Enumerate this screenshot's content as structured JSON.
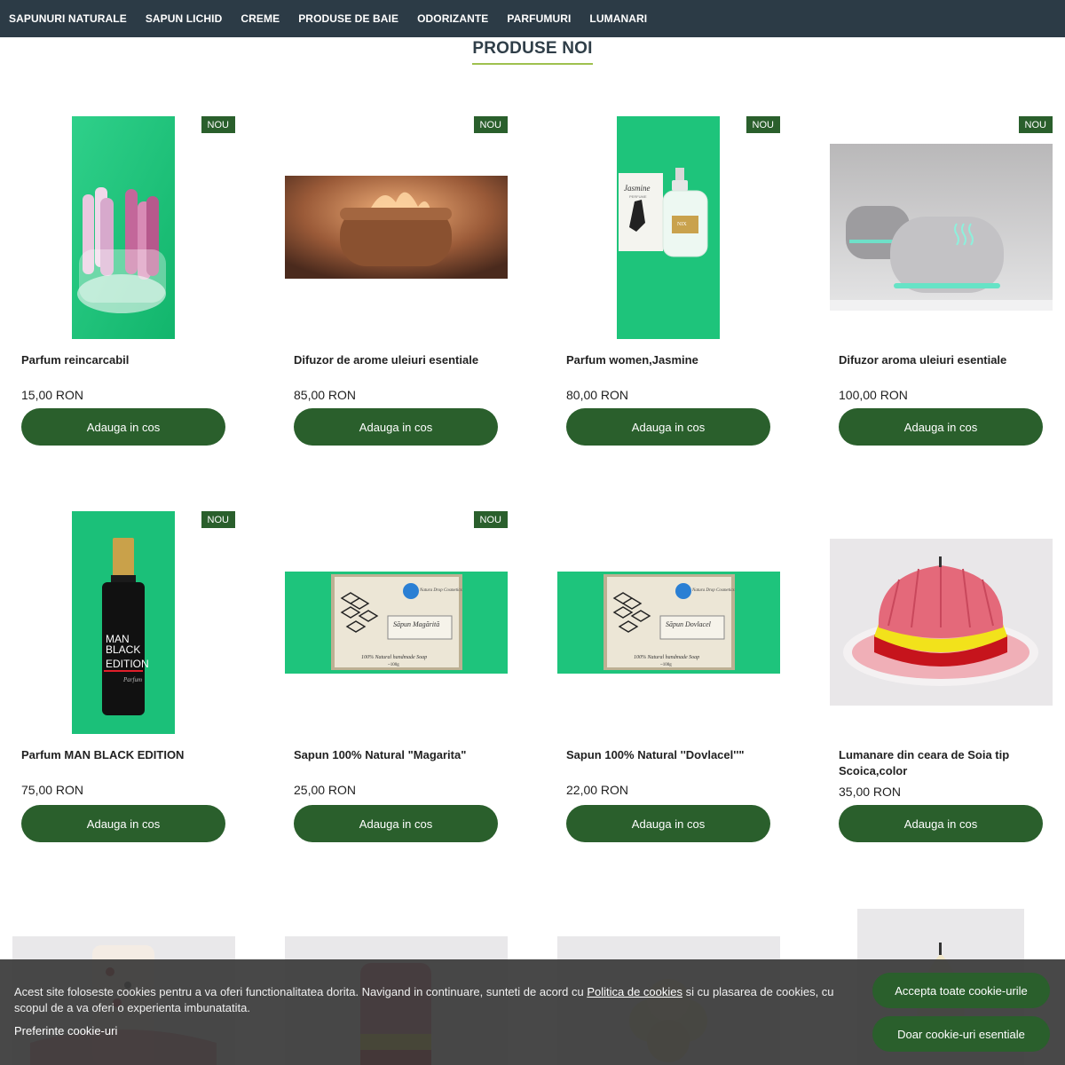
{
  "nav": {
    "items": [
      "SAPUNURI NATURALE",
      "SAPUN LICHID",
      "CREME",
      "PRODUSE DE BAIE",
      "ODORIZANTE",
      "PARFUMURI",
      "LUMANARI"
    ]
  },
  "section": {
    "title": "PRODUSE NOI"
  },
  "badge_label": "NOU",
  "add_to_cart_label": "Adauga in cos",
  "products": [
    {
      "title": "Parfum reincarcabil",
      "price": "15,00 RON",
      "badge": "NOU"
    },
    {
      "title": "Difuzor de arome uleiuri esentiale",
      "price": "85,00 RON",
      "badge": "NOU"
    },
    {
      "title": "Parfum women,Jasmine",
      "price": "80,00 RON",
      "badge": "NOU"
    },
    {
      "title": "Difuzor aroma uleiuri esentiale",
      "price": "100,00 RON",
      "badge": "NOU"
    },
    {
      "title": "Parfum MAN BLACK EDITION",
      "price": "75,00 RON",
      "badge": "NOU"
    },
    {
      "title": "Sapun 100% Natural \"Magarita\"",
      "price": "25,00 RON",
      "badge": "NOU"
    },
    {
      "title": "Sapun 100% Natural ''Dovlacel''\"",
      "price": "22,00 RON"
    },
    {
      "title": "Lumanare din ceara de Soia tip Scoica,color",
      "price": "35,00 RON"
    }
  ],
  "image_text": {
    "jasmine_box": "Jasmine",
    "jasmine_box_sub": "PERFUME",
    "jasmine_label": "NIX",
    "man_label_1": "MAN",
    "man_label_2": "BLACK",
    "man_label_3": "EDITION",
    "man_label_4": "Parfum",
    "soap_brand": "Natura Drop Cosmetics",
    "soap1_name": "Săpun Magărită",
    "soap2_name": "Săpun Dovlacel",
    "soap_footer": "100% Natural handmade Soap",
    "soap_weight": "~100g"
  },
  "cookie": {
    "text_before": "Acest site foloseste cookies pentru a va oferi functionalitatea dorita. Navigand in continuare, sunteti de acord cu ",
    "policy_link": "Politica de cookies",
    "text_after": " si cu plasarea de cookies, cu scopul de a va oferi o experienta imbunatatita.",
    "preferences": "Preferinte cookie-uri",
    "accept_all": "Accepta toate cookie-urile",
    "essential_only": "Doar cookie-uri esentiale"
  },
  "colors": {
    "nav_bg": "#2c3b46",
    "accent_green": "#2a5f2c",
    "title_underline": "#9fc14e",
    "product_bg_green": "#19c77b",
    "cookie_bg": "#3a3a3a"
  }
}
